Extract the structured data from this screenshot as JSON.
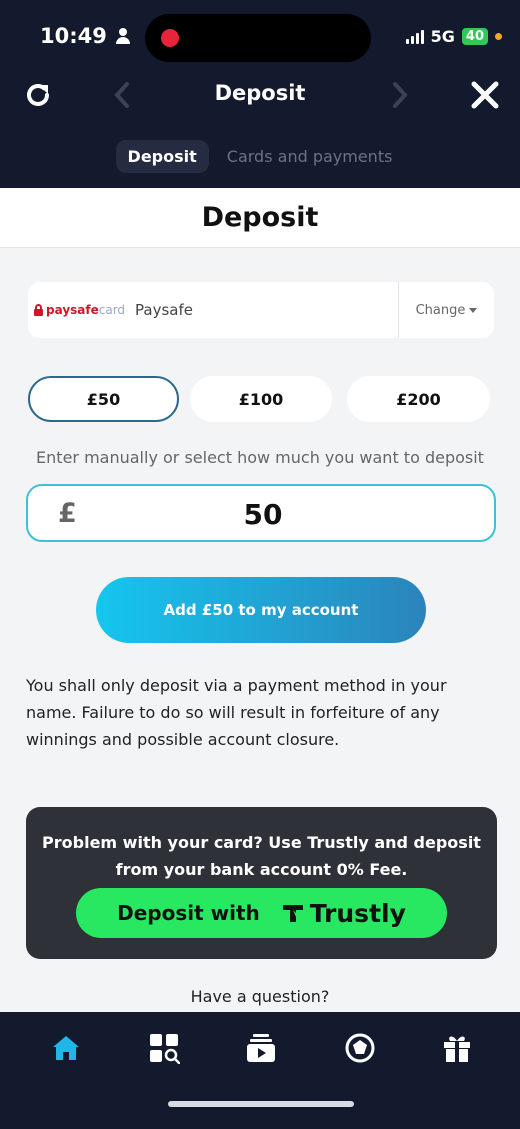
{
  "status_bar": {
    "time": "10:49",
    "network": "5G",
    "battery": "40"
  },
  "header": {
    "title": "Deposit"
  },
  "tabs": [
    {
      "label": "Deposit",
      "active": true
    },
    {
      "label": "Cards and payments",
      "active": false
    }
  ],
  "page": {
    "title": "Deposit"
  },
  "payment_method": {
    "logo_part1": "paysafe",
    "logo_part2": "card",
    "name": "Paysafe",
    "change_label": "Change"
  },
  "amounts": [
    {
      "label": "£50",
      "selected": true
    },
    {
      "label": "£100",
      "selected": false
    },
    {
      "label": "£200",
      "selected": false
    }
  ],
  "hint": "Enter manually or select how much you want to deposit",
  "amount_input": {
    "currency": "£",
    "value": "50"
  },
  "add_button_label": "Add £50 to my account",
  "disclaimer": "You shall only deposit via a payment method in your name. Failure to do so will result in forfeiture of any winnings and possible account closure.",
  "trustly": {
    "message": "Problem with your card? Use Trustly and deposit from your bank account 0% Fee.",
    "button_label": "Deposit with",
    "brand": "Trustly"
  },
  "question": "Have a question?",
  "bottom_nav": [
    {
      "icon": "home-icon",
      "active": true
    },
    {
      "icon": "search-games-icon",
      "active": false
    },
    {
      "icon": "live-games-icon",
      "active": false
    },
    {
      "icon": "sports-ball-icon",
      "active": false
    },
    {
      "icon": "gift-icon",
      "active": false
    }
  ],
  "colors": {
    "accent": "#1fb6e8",
    "trustly_green": "#27e860",
    "dark": "#141a2e"
  }
}
